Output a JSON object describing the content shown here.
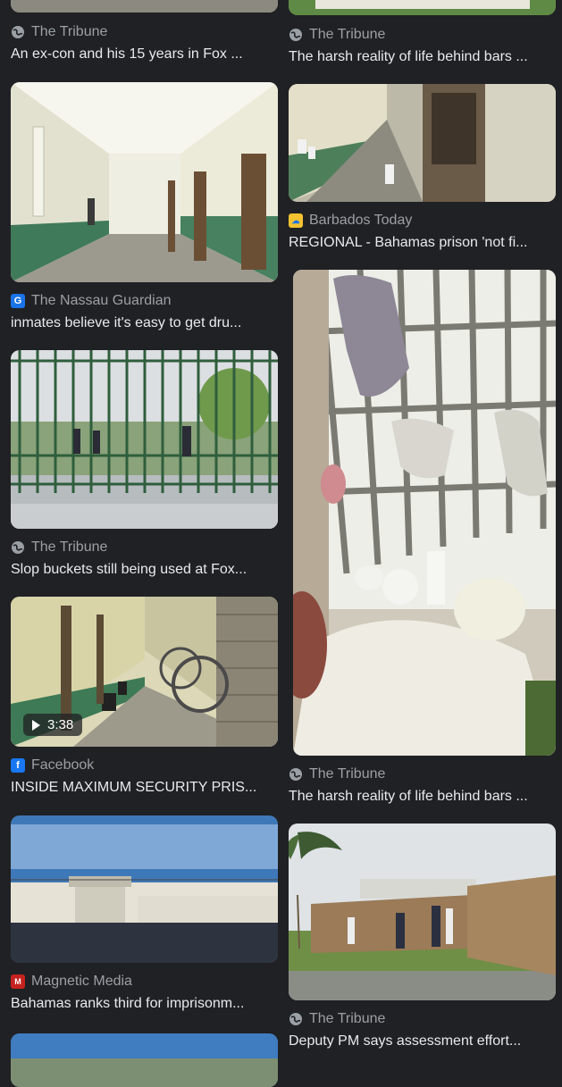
{
  "results": {
    "left": [
      {
        "source": "The Tribune",
        "source_icon": "globe-icon",
        "caption": "An ex-con and his 15 years in Fox ..."
      },
      {
        "source": "The Nassau Guardian",
        "source_icon": "nassau-guardian-logo-icon",
        "caption": "inmates believe it's easy to get dru..."
      },
      {
        "source": "The Tribune",
        "source_icon": "globe-icon",
        "caption": "Slop buckets still being used at Fox..."
      },
      {
        "source": "Facebook",
        "source_icon": "facebook-logo-icon",
        "caption": "INSIDE MAXIMUM SECURITY PRIS...",
        "video_duration": "3:38"
      },
      {
        "source": "Magnetic Media",
        "source_icon": "magnetic-media-logo-icon",
        "caption": "Bahamas ranks third for imprisonm..."
      }
    ],
    "right": [
      {
        "source": "The Tribune",
        "source_icon": "globe-icon",
        "caption": "The harsh reality of life behind bars ..."
      },
      {
        "source": "Barbados Today",
        "source_icon": "barbados-today-logo-icon",
        "caption": "REGIONAL - Bahamas prison 'not fi..."
      },
      {
        "source": "The Tribune",
        "source_icon": "globe-icon",
        "caption": "The harsh reality of life behind bars ..."
      },
      {
        "source": "The Tribune",
        "source_icon": "globe-icon",
        "caption": "Deputy PM says assessment effort..."
      }
    ]
  },
  "colors": {
    "background": "#202124",
    "caption_text": "#e8eaed",
    "source_text": "#9aa0a6"
  }
}
